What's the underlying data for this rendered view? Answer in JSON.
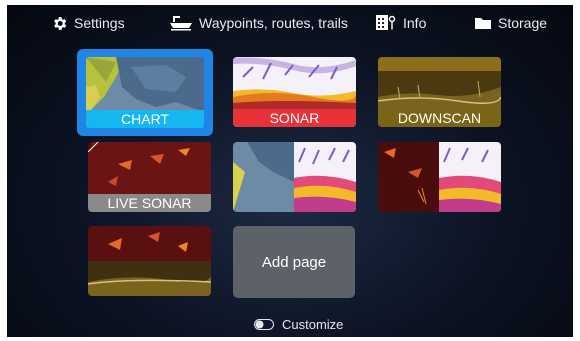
{
  "topbar": {
    "settings_label": "Settings",
    "waypoints_label": "Waypoints, routes, trails",
    "info_label": "Info",
    "storage_label": "Storage"
  },
  "tiles": {
    "chart_label": "CHART",
    "sonar_label": "SONAR",
    "downscan_label": "DOWNSCAN",
    "live_sonar_label": "LIVE SONAR"
  },
  "add_page_label": "Add page",
  "customize_label": "Customize",
  "colors": {
    "chart_label_bg": "#16b6f0",
    "sonar_label_bg": "#e8323a",
    "downscan_label_bg": "#7a6416",
    "live_sonar_label_bg": "#8a8a8a",
    "selection": "#1f86e8"
  }
}
